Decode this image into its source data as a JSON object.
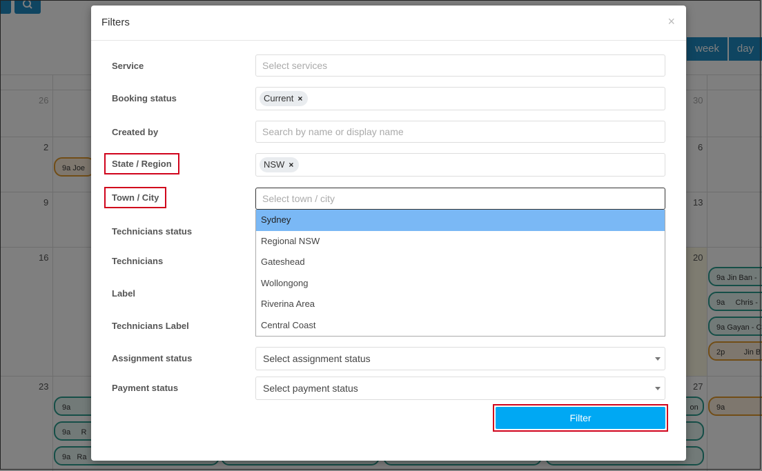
{
  "calendar": {
    "view_buttons": [
      "week",
      "day"
    ],
    "day_numbers": {
      "row1": [
        "26",
        "30"
      ],
      "row2": [
        "2",
        "6"
      ],
      "row3": [
        "9",
        "13"
      ],
      "row4": [
        "16",
        "20"
      ],
      "row5": [
        "23",
        "27"
      ]
    },
    "events": [
      {
        "time": "9a",
        "label": "Joe"
      },
      {
        "time": "9a",
        "label": "Jin Ban -"
      },
      {
        "time": "9a",
        "label": "Chris -"
      },
      {
        "time": "9a",
        "label": "Gayan - C"
      },
      {
        "time": "2p",
        "label": "Jin B"
      },
      {
        "time": "9a",
        "label": ""
      },
      {
        "time": "9a",
        "label": "R"
      },
      {
        "time": "9a",
        "label": "Ra"
      },
      {
        "time": "",
        "label": "on"
      },
      {
        "time": "9a",
        "label": ""
      }
    ]
  },
  "modal": {
    "title": "Filters",
    "close": "×",
    "fields": {
      "service": {
        "label": "Service",
        "placeholder": "Select services"
      },
      "booking_status": {
        "label": "Booking status",
        "tag": "Current"
      },
      "created_by": {
        "label": "Created by",
        "placeholder": "Search by name or display name"
      },
      "state_region": {
        "label": "State / Region",
        "tag": "NSW"
      },
      "town_city": {
        "label": "Town / City",
        "placeholder": "Select town / city"
      },
      "technicians_status": {
        "label": "Technicians status"
      },
      "technicians": {
        "label": "Technicians"
      },
      "label": {
        "label": "Label"
      },
      "technicians_label": {
        "label": "Technicians Label"
      },
      "assignment_status": {
        "label": "Assignment status",
        "value": "Select assignment status"
      },
      "payment_status": {
        "label": "Payment status",
        "value": "Select payment status"
      }
    },
    "town_options": [
      "Sydney",
      "Regional NSW",
      "Gateshead",
      "Wollongong",
      "Riverina Area",
      "Central Coast"
    ],
    "tag_remove": "×",
    "filter_button": "Filter"
  }
}
